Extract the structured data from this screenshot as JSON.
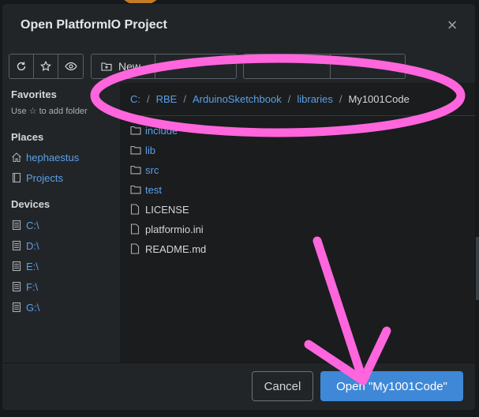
{
  "dialog": {
    "title": "Open PlatformIO Project",
    "close_icon": "close-icon"
  },
  "toolbar": {
    "refresh_icon": "refresh-icon",
    "favorite_icon": "star-icon",
    "visibility_icon": "eye-icon",
    "new_label": "New",
    "new_icon": "folder-plus-icon"
  },
  "sidebar": {
    "favorites_heading": "Favorites",
    "favorites_hint_prefix": "Use",
    "favorites_hint_suffix": "to add folder",
    "places_heading": "Places",
    "places": [
      {
        "label": "hephaestus",
        "icon": "home-icon"
      },
      {
        "label": "Projects",
        "icon": "book-icon"
      }
    ],
    "devices_heading": "Devices",
    "devices": [
      {
        "label": "C:\\",
        "icon": "drive-icon"
      },
      {
        "label": "D:\\",
        "icon": "drive-icon"
      },
      {
        "label": "E:\\",
        "icon": "drive-icon"
      },
      {
        "label": "F:\\",
        "icon": "drive-icon"
      },
      {
        "label": "G:\\",
        "icon": "drive-icon"
      }
    ]
  },
  "breadcrumb": {
    "items": [
      "C:",
      "RBE",
      "ArduinoSketchbook",
      "libraries"
    ],
    "separator": "/",
    "current": "My1001Code"
  },
  "files": [
    {
      "name": "include",
      "type": "folder"
    },
    {
      "name": "lib",
      "type": "folder"
    },
    {
      "name": "src",
      "type": "folder"
    },
    {
      "name": "test",
      "type": "folder"
    },
    {
      "name": "LICENSE",
      "type": "file"
    },
    {
      "name": "platformio.ini",
      "type": "file"
    },
    {
      "name": "README.md",
      "type": "file"
    }
  ],
  "footer": {
    "cancel_label": "Cancel",
    "open_label": "Open \"My1001Code\""
  },
  "annotation": {
    "color": "#ff66dd",
    "shapes": [
      "ellipse-around-breadcrumb",
      "arrow-to-open-button"
    ]
  }
}
